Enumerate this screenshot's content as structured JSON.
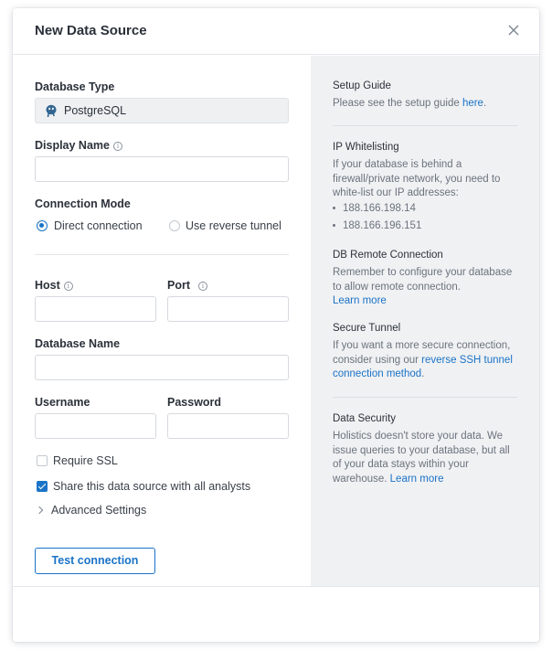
{
  "modal": {
    "title": "New Data Source",
    "close_icon": "close-icon"
  },
  "form": {
    "database_type": {
      "label": "Database Type",
      "value": "PostgreSQL",
      "icon": "postgresql-icon"
    },
    "display_name": {
      "label": "Display Name",
      "value": "",
      "info_icon": "info-icon"
    },
    "connection_mode": {
      "label": "Connection Mode",
      "options": [
        {
          "label": "Direct connection",
          "selected": true
        },
        {
          "label": "Use reverse tunnel",
          "selected": false
        }
      ]
    },
    "host": {
      "label": "Host",
      "value": ""
    },
    "port": {
      "label": "Port",
      "value": ""
    },
    "database_name": {
      "label": "Database Name",
      "value": ""
    },
    "username": {
      "label": "Username",
      "value": ""
    },
    "password": {
      "label": "Password",
      "value": ""
    },
    "require_ssl": {
      "label": "Require SSL",
      "checked": false
    },
    "share": {
      "label": "Share this data source with all analysts",
      "checked": true
    },
    "advanced": {
      "label": "Advanced Settings"
    },
    "test_button": "Test connection"
  },
  "guide": {
    "setup": {
      "title": "Setup Guide",
      "text": "Please see the setup guide ",
      "link": "here",
      "after": "."
    },
    "whitelist": {
      "title": "IP Whitelisting",
      "text": "If your database is behind a firewall/private network, you need to white-list our IP addresses:",
      "ips": [
        "188.166.198.14",
        "188.166.196.151"
      ]
    },
    "remote": {
      "title": "DB Remote Connection",
      "text": "Remember to configure your database to allow remote connection.",
      "link": "Learn more"
    },
    "tunnel": {
      "title": "Secure Tunnel",
      "text": "If you want a more secure connection, consider using our ",
      "link": "reverse SSH tunnel connection method",
      "after": "."
    },
    "security": {
      "title": "Data Security",
      "text": "Holistics doesn't store your data. We issue queries to your database, but all of your data stays within your warehouse. ",
      "link": "Learn more"
    }
  },
  "colors": {
    "accent": "#1a73c7",
    "panel": "#f0f1f3"
  }
}
